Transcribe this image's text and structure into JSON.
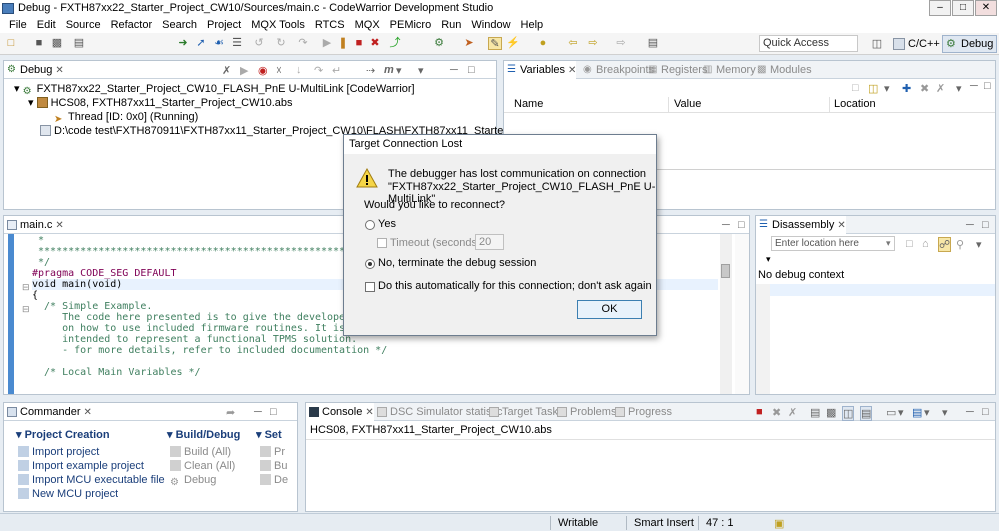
{
  "window": {
    "title": "Debug - FXTH87xx22_Starter_Project_CW10/Sources/main.c - CodeWarrior Development Studio",
    "minimize": "–",
    "maximize": "□",
    "close": "✕"
  },
  "menu": [
    "File",
    "Edit",
    "Source",
    "Refactor",
    "Search",
    "Project",
    "MQX Tools",
    "RTCS",
    "MQX",
    "PEMicro",
    "Run",
    "Window",
    "Help"
  ],
  "toolbar": {
    "quick_access_placeholder": "Quick Access",
    "perspectives": [
      "C/C++",
      "Debug"
    ]
  },
  "debug_view": {
    "tab": "Debug",
    "tree": [
      "FXTH87xx22_Starter_Project_CW10_FLASH_PnE U-MultiLink [CodeWarrior]",
      "HCS08, FXTH87xx11_Starter_Project_CW10.abs",
      "Thread [ID: 0x0] (Running)",
      "D:\\code test\\FXTH870911\\FXTH87xx11_Starter_Project_CW10\\FLASH\\FXTH87xx11_Starter_Project_CW10."
    ]
  },
  "variables_view": {
    "tabs": [
      "Variables",
      "Breakpoints",
      "Registers",
      "Memory",
      "Modules"
    ],
    "columns": [
      "Name",
      "Value",
      "Location"
    ]
  },
  "editor": {
    "tab": "main.c",
    "lines": [
      " *",
      " *****************************************************************************",
      " */",
      "#pragma CODE_SEG DEFAULT",
      "void main(void)",
      "{",
      "  /* Simple Example.",
      "     The code here presented is to give the developer a point",
      "     on how to use included firmware routines. It is in no ma",
      "     intended to represent a functional TPMS solution.",
      "     - for more details, refer to included documentation */",
      "",
      "  /* Local Main Variables */"
    ]
  },
  "disassembly_view": {
    "tab": "Disassembly",
    "location_placeholder": "Enter location here",
    "message": "No debug context"
  },
  "commander_view": {
    "tab": "Commander",
    "sections": [
      {
        "title": "Project Creation",
        "items": [
          "Import project",
          "Import example project",
          "Import MCU executable file",
          "New MCU project"
        ]
      },
      {
        "title": "Build/Debug",
        "items": [
          "Build  (All)",
          "Clean  (All)",
          "Debug"
        ]
      },
      {
        "title": "Set",
        "items": [
          "Pr",
          "Bu",
          "De"
        ]
      }
    ]
  },
  "console_view": {
    "tabs": [
      "Console",
      "DSC Simulator statistic",
      "Target Tasks",
      "Problems",
      "Progress"
    ],
    "output": "HCS08, FXTH87xx11_Starter_Project_CW10.abs"
  },
  "dialog": {
    "title": "Target Connection Lost",
    "message_line1": "The debugger has lost communication on connection",
    "message_line2": "\"FXTH87xx22_Starter_Project_CW10_FLASH_PnE U-MultiLink\"",
    "question": "Would you like to reconnect?",
    "option_yes": "Yes",
    "timeout_label": "Timeout (seconds):",
    "timeout_value": "20",
    "option_no": "No, terminate the debug session",
    "auto_label": "Do this automatically for this connection; don't ask again",
    "ok": "OK"
  },
  "statusbar": {
    "mode": "Writable",
    "insert": "Smart Insert",
    "position": "47 : 1"
  },
  "colors": {
    "accent": "#3c7fb1",
    "comment": "#3f7f5f",
    "keyword": "#7f0055"
  }
}
